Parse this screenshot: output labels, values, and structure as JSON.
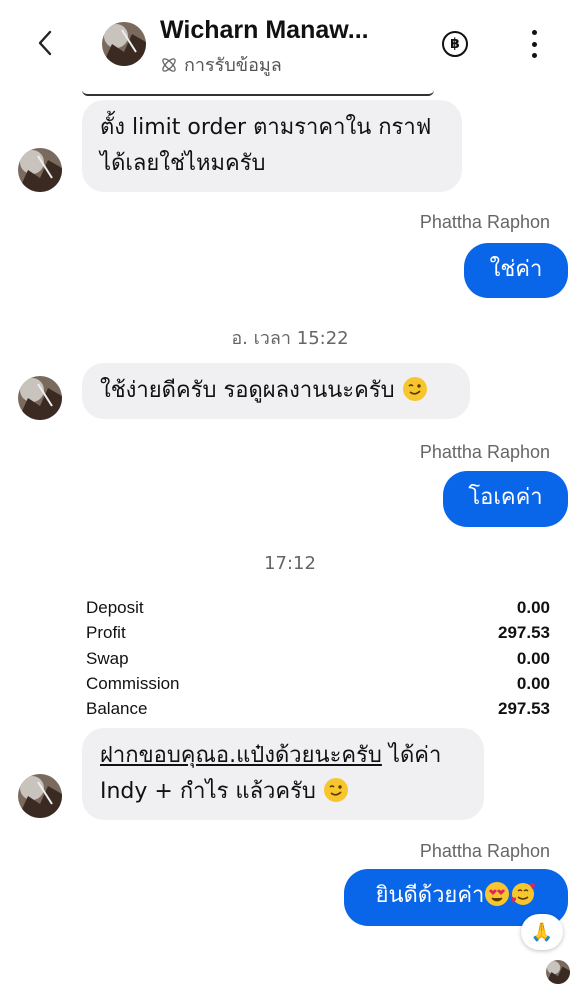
{
  "header": {
    "contact_name": "Wicharn Manaw...",
    "status_text": "การรับข้อมูล",
    "back_icon": "chevron-left-icon",
    "baht_icon": "baht-icon",
    "menu_icon": "more-vertical-icon"
  },
  "messages": {
    "m1": {
      "line1": "ตั้ง limit order ตามราคาใน กราฟ",
      "line2": "ได้เลยใช่ไหมครับ"
    },
    "sender_1": "Phattha Raphon",
    "m2": "ใช่ค่า",
    "timestamp_1": "อ. เวลา 15:22",
    "m3": "ใช้ง่ายดีครับ รอดูผลงานนะครับ",
    "sender_2": "Phattha Raphon",
    "m4": "โอเคค่า",
    "timestamp_2": "17:12",
    "m5": {
      "underlined": "ฝากขอบคุณอ.แป๋งด้วยนะครับ",
      "rest": " ได้ค่า",
      "line2": "Indy + กำไร แล้วครับ"
    },
    "sender_3": "Phattha Raphon",
    "m6": "ยินดีด้วยค่า"
  },
  "report": [
    {
      "label": "Deposit",
      "value": "0.00"
    },
    {
      "label": "Profit",
      "value": "297.53"
    },
    {
      "label": "Swap",
      "value": "0.00"
    },
    {
      "label": "Commission",
      "value": "0.00"
    },
    {
      "label": "Balance",
      "value": "297.53"
    }
  ],
  "reaction": "🙏",
  "colors": {
    "outgoing_bubble": "#0a66e8",
    "incoming_bubble": "#f0f0f3"
  }
}
